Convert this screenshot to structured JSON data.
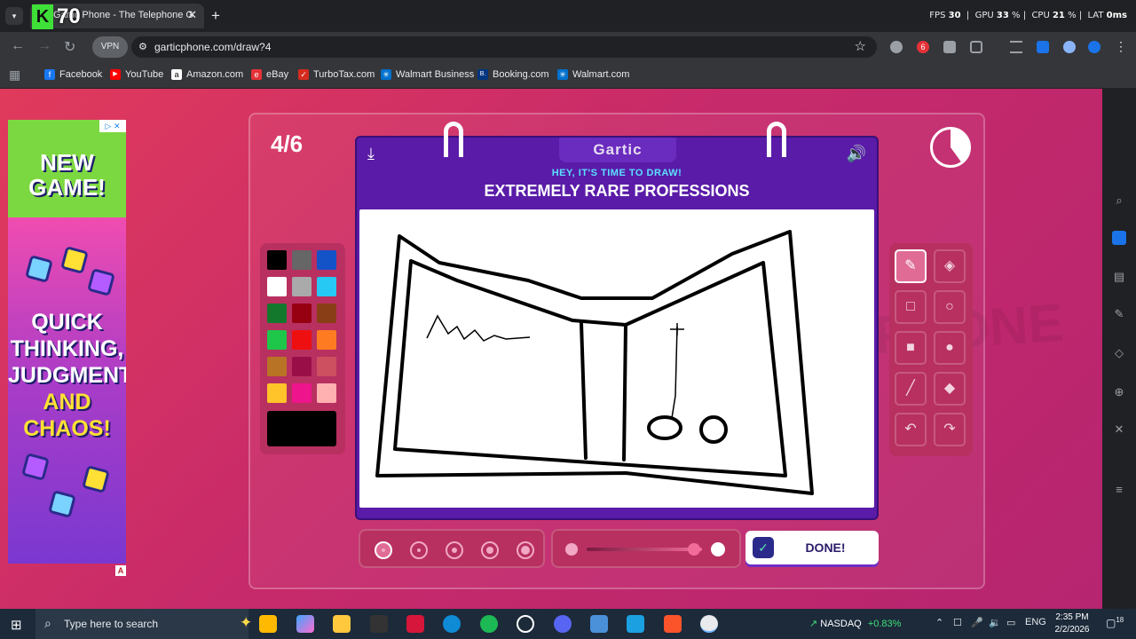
{
  "browser": {
    "tab_title": "Gartic Phone - The Telephone G",
    "new_tab": "+",
    "overlay_badge": "K",
    "overlay_count": "70",
    "stats": {
      "fps_label": "FPS",
      "fps": "30",
      "gpu_label": "GPU",
      "gpu": "33",
      "cpu_label": "CPU",
      "cpu": "21",
      "lat_label": "LAT",
      "lat": "0ms"
    },
    "vpn_label": "VPN",
    "url": "garticphone.com/draw?4",
    "extension_badge": "6"
  },
  "bookmarks": [
    {
      "label": "Facebook",
      "icon": "facebook-icon",
      "color": "#1877f2",
      "glyph": "f"
    },
    {
      "label": "YouTube",
      "icon": "youtube-icon",
      "color": "#ff0000",
      "glyph": "▶"
    },
    {
      "label": "Amazon.com",
      "icon": "amazon-icon",
      "color": "#ffffff",
      "glyph": "a"
    },
    {
      "label": "eBay",
      "icon": "ebay-icon",
      "color": "#e53238",
      "glyph": "e"
    },
    {
      "label": "TurboTax.com",
      "icon": "turbotax-icon",
      "color": "#d52b1e",
      "glyph": "✓"
    },
    {
      "label": "Walmart Business",
      "icon": "walmart-icon",
      "color": "#0071ce",
      "glyph": "✳"
    },
    {
      "label": "Booking.com",
      "icon": "booking-icon",
      "color": "#003580",
      "glyph": "B."
    },
    {
      "label": "Walmart.com",
      "icon": "walmart-icon",
      "color": "#0071ce",
      "glyph": "✳"
    }
  ],
  "ad": {
    "headline": "NEW GAME!",
    "body_line1": "QUICK",
    "body_line2": "THINKING,",
    "body_line3": "JUDGMENT",
    "body_line4": "AND",
    "body_line5": "CHAOS!",
    "choices_label": "▷ ✕",
    "badge": "A"
  },
  "game": {
    "round": "4/6",
    "logo": "Gartic",
    "subtitle": "HEY, IT'S TIME TO DRAW!",
    "prompt": "EXTREMELY RARE PROFESSIONS",
    "done_label": "DONE!",
    "watermark": "PHONE",
    "palette": [
      "#000000",
      "#666666",
      "#1452c8",
      "#ffffff",
      "#aaaaaa",
      "#26c8f4",
      "#14782c",
      "#960010",
      "#8a3e16",
      "#1ec64a",
      "#ee1010",
      "#ff7b22",
      "#b87424",
      "#9a0e48",
      "#cc5060",
      "#ffc42a",
      "#ee148c",
      "#ffb0b0"
    ],
    "current_color": "#000000",
    "accent": "#b83060"
  },
  "taskbar": {
    "search_placeholder": "Type here to search",
    "nasdaq_label": "NASDAQ",
    "nasdaq_change": "+0.83%",
    "lang": "ENG",
    "time": "2:35 PM",
    "date": "2/2/2026",
    "notif_count": "18"
  }
}
